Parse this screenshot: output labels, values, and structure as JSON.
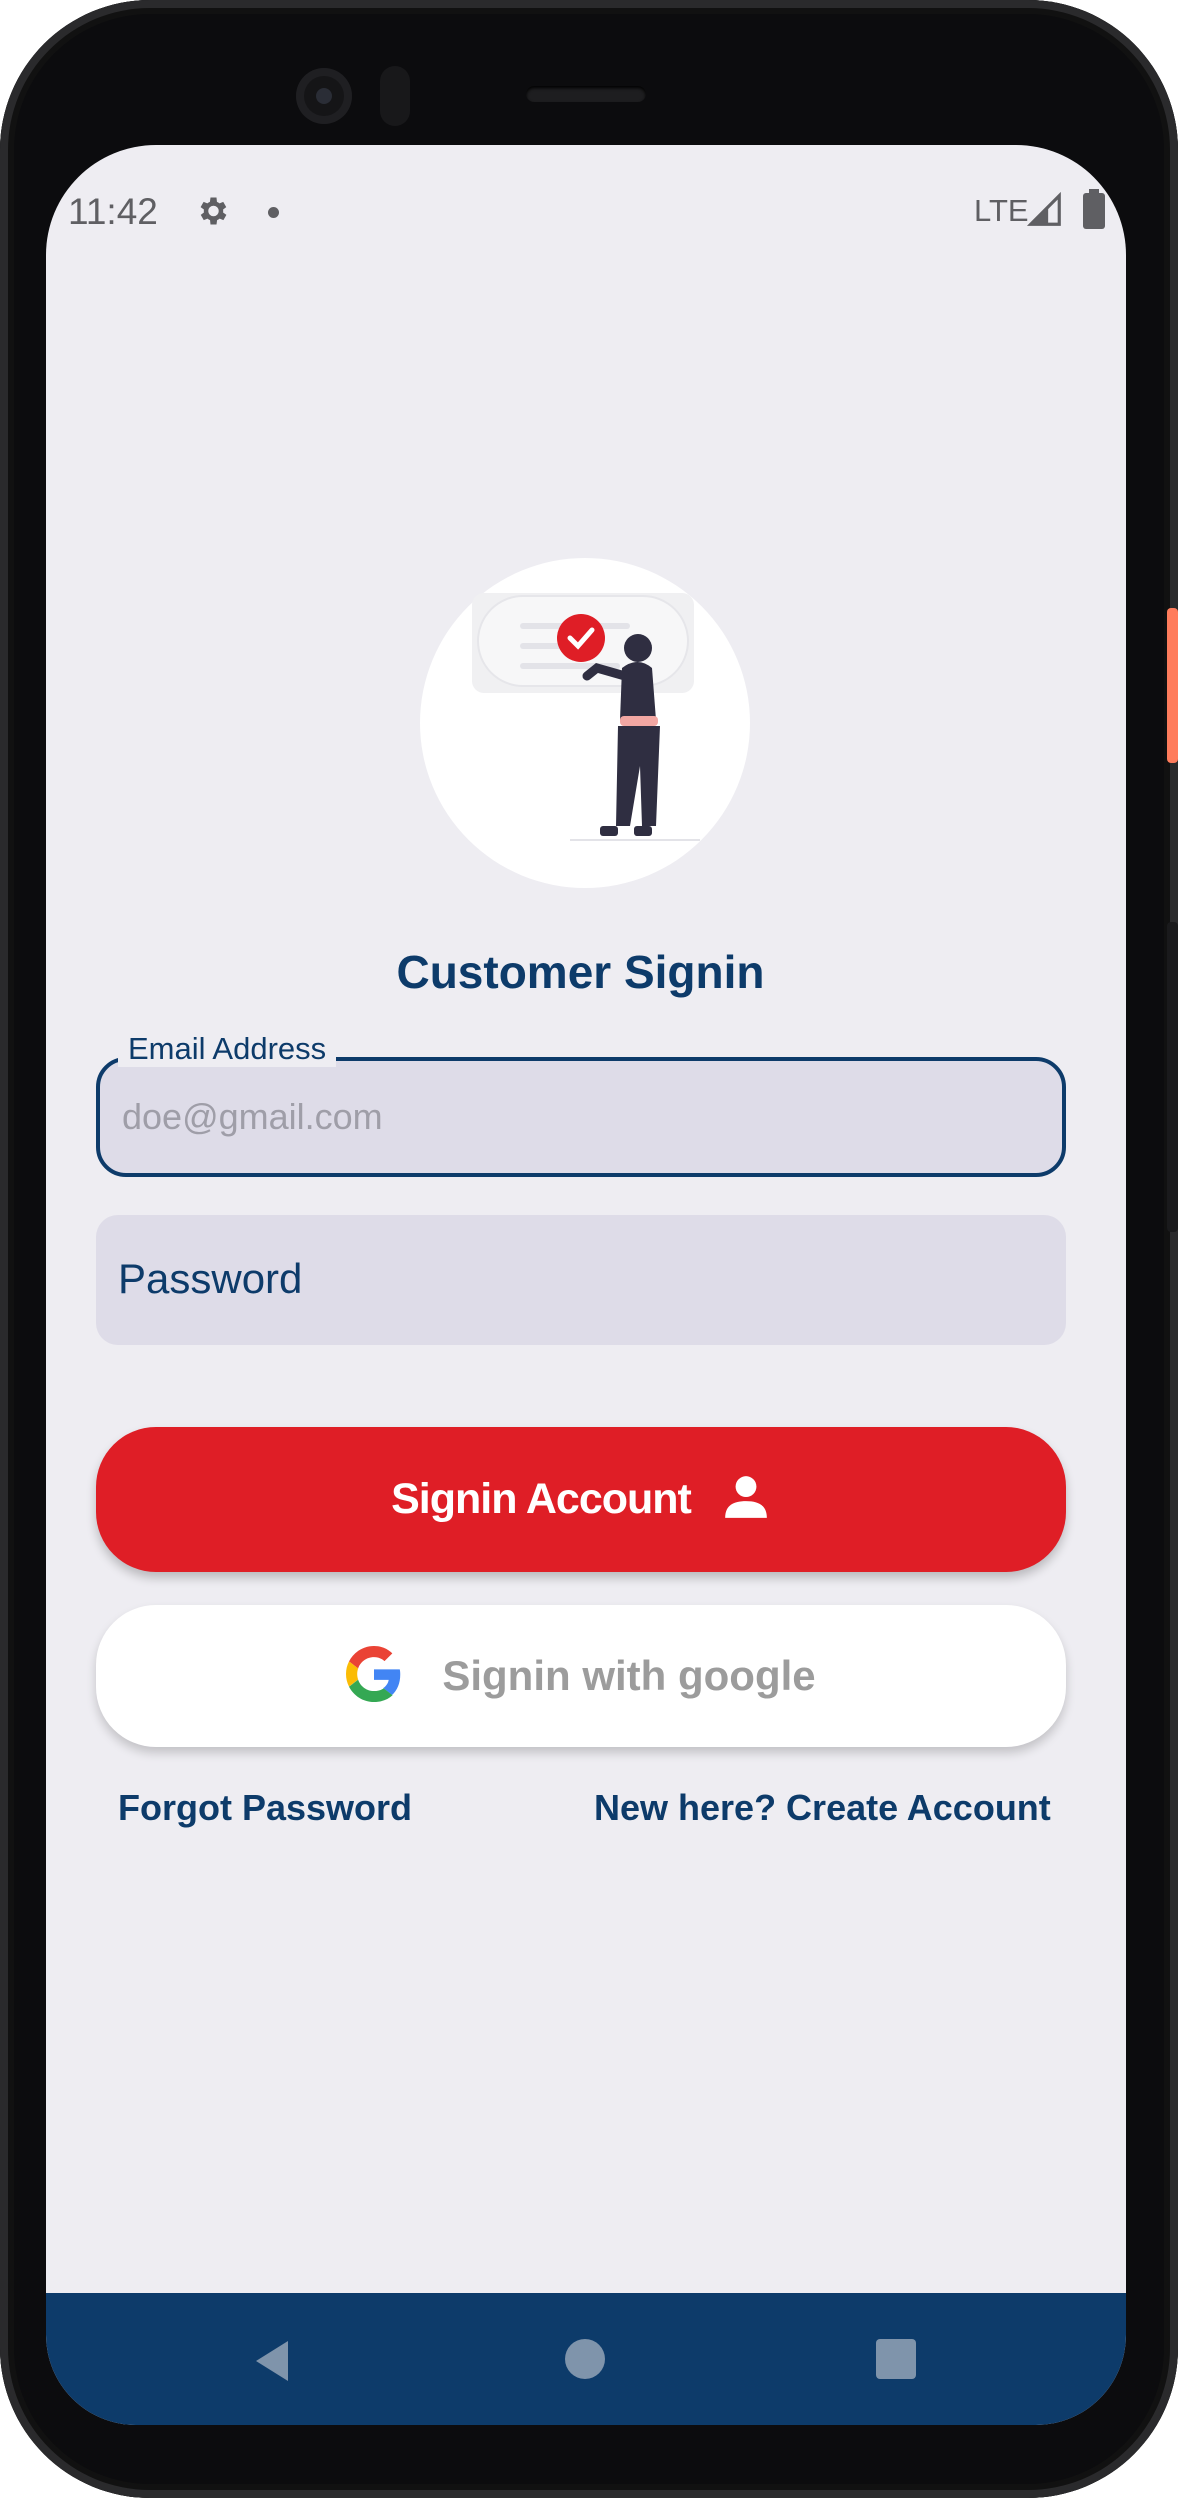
{
  "status_bar": {
    "time": "11:42",
    "network": "LTE",
    "icons": [
      "gear-icon",
      "notification-dot-icon",
      "signal-icon",
      "battery-icon"
    ]
  },
  "header": {
    "illustration": "person-with-checkmark-illustration",
    "title": "Customer Signin"
  },
  "form": {
    "email": {
      "label": "Email Address",
      "placeholder": "doe@gmail.com",
      "value": ""
    },
    "password": {
      "label": "Password",
      "value": ""
    }
  },
  "actions": {
    "signin_label": "Signin Account",
    "signin_icon": "person-icon",
    "google_label": "Signin with google",
    "google_icon": "google-icon"
  },
  "links": {
    "forgot": "Forgot Password",
    "create": "New here? Create Account"
  },
  "colors": {
    "brand": "#0d3b6a",
    "primary_button": "#df1e26",
    "background": "#eeedf2",
    "field_fill": "#dedce8"
  },
  "nav_bar": {
    "buttons": [
      "back-icon",
      "home-icon",
      "recents-icon"
    ]
  }
}
